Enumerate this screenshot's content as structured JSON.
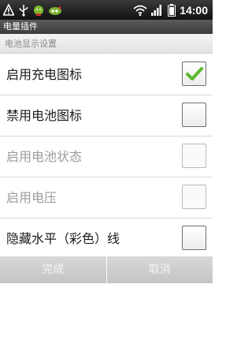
{
  "status_bar": {
    "time": "14:00",
    "icons": [
      "warning-icon",
      "usb-icon",
      "battery-widget-icon",
      "app-notification-icon",
      "wifi-icon",
      "signal-icon",
      "battery-icon"
    ]
  },
  "window": {
    "title": "电量插件"
  },
  "section": {
    "header": "电池显示设置"
  },
  "settings": [
    {
      "label": "启用充电图标",
      "checked": true,
      "enabled": true
    },
    {
      "label": "禁用电池图标",
      "checked": false,
      "enabled": true
    },
    {
      "label": "启用电池状态",
      "checked": false,
      "enabled": false
    },
    {
      "label": "启用电压",
      "checked": false,
      "enabled": false
    },
    {
      "label": "隐藏水平（彩色）线",
      "checked": false,
      "enabled": true
    }
  ],
  "buttons": {
    "ok": "完成",
    "cancel": "取消"
  },
  "colors": {
    "check": "#5cb82e",
    "button_bg": "#cccccc",
    "section_text": "#8a8a8a"
  }
}
